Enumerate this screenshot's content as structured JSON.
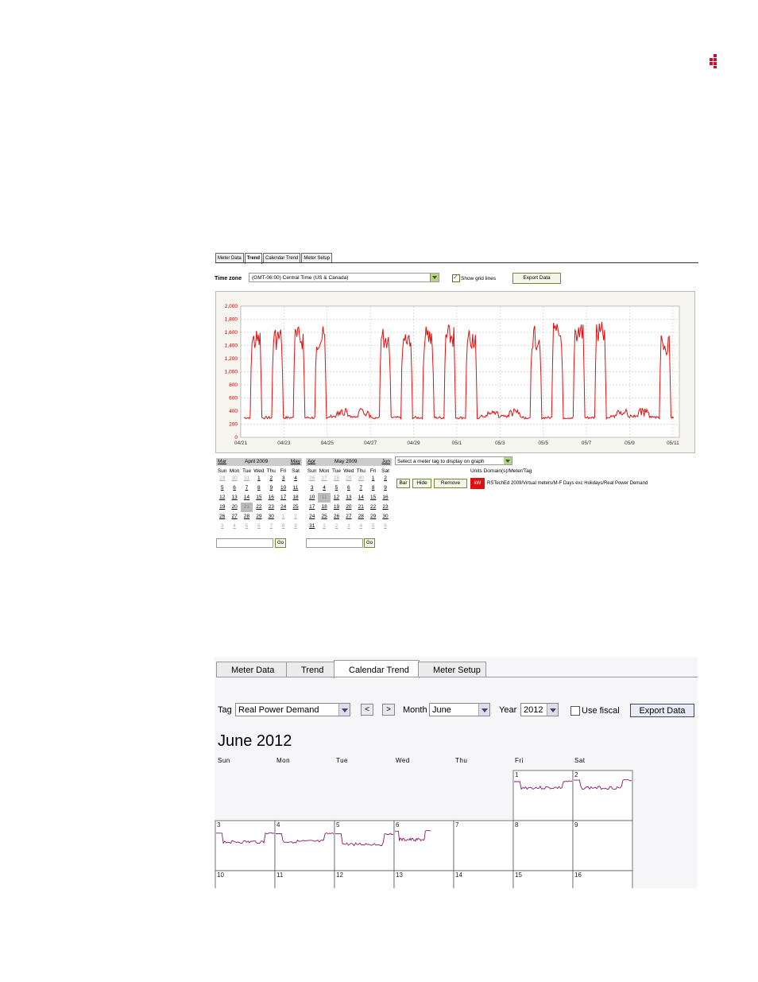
{
  "brand": {
    "logo_icon": "red-square-dots-logo",
    "accent": "#c8102e"
  },
  "trend_screen": {
    "tabs": [
      {
        "label": "Meter Data"
      },
      {
        "label": "Trend",
        "active": true
      },
      {
        "label": "Calendar Trend"
      },
      {
        "label": "Meter Setup"
      }
    ],
    "time_zone_label": "Time zone",
    "time_zone_value": "(GMT-06:00) Central Time (US & Canada)",
    "show_grid_lines_label": "Show grid lines",
    "show_grid_lines_checked": true,
    "export_label": "Export Data",
    "calendars": [
      {
        "prev": "Mar",
        "title": "April 2009",
        "next": "May",
        "dow": [
          "Sun",
          "Mon",
          "Tue",
          "Wed",
          "Thu",
          "Fri",
          "Sat"
        ],
        "weeks": [
          [
            "29",
            "30",
            "31",
            "1",
            "2",
            "3",
            "4"
          ],
          [
            "5",
            "6",
            "7",
            "8",
            "9",
            "10",
            "11"
          ],
          [
            "12",
            "13",
            "14",
            "15",
            "16",
            "17",
            "18"
          ],
          [
            "19",
            "20",
            "21",
            "22",
            "23",
            "24",
            "25"
          ],
          [
            "26",
            "27",
            "28",
            "29",
            "30",
            "1",
            "2"
          ],
          [
            "3",
            "4",
            "5",
            "6",
            "7",
            "8",
            "9"
          ]
        ],
        "go_label": "Go"
      },
      {
        "prev": "Apr",
        "title": "May 2009",
        "next": "Jun",
        "dow": [
          "Sun",
          "Mon",
          "Tue",
          "Wed",
          "Thu",
          "Fri",
          "Sat"
        ],
        "weeks": [
          [
            "26",
            "27",
            "28",
            "29",
            "30",
            "1",
            "2"
          ],
          [
            "3",
            "4",
            "5",
            "6",
            "7",
            "8",
            "9"
          ],
          [
            "10",
            "11",
            "12",
            "13",
            "14",
            "15",
            "16"
          ],
          [
            "17",
            "18",
            "19",
            "20",
            "21",
            "22",
            "23"
          ],
          [
            "24",
            "25",
            "26",
            "27",
            "28",
            "29",
            "30"
          ],
          [
            "31",
            "1",
            "2",
            "3",
            "4",
            "5",
            "6"
          ]
        ],
        "go_label": "Go"
      }
    ],
    "meter_tag_select": "Select a meter tag to display on graph",
    "units_header": "Units Domain(s)/Meter/Tag",
    "buttons": {
      "bar": "Bar",
      "hide": "Hide",
      "remove": "Remove"
    },
    "unit_badge": "kW",
    "tag_path": "RSTechEd 2009/Virtual meters/M-F Days exc Holidays/Real Power Demand"
  },
  "chart_data": {
    "type": "line",
    "x_tick_labels": [
      "04/21",
      "04/23",
      "04/25",
      "04/27",
      "04/29",
      "05/1",
      "05/3",
      "05/5",
      "05/7",
      "05/9",
      "05/11"
    ],
    "y_tick_labels": [
      "0",
      "200",
      "400",
      "600",
      "800",
      "1,000",
      "1,200",
      "1,400",
      "1,600",
      "1,800",
      "2,000"
    ],
    "ylim": [
      0,
      2000
    ],
    "grid": true,
    "line_color": "#e01010",
    "series": [
      {
        "daily_peak": [
          1650,
          1700,
          1700,
          1700,
          440,
          440,
          1700,
          1720,
          1700,
          1720,
          1720,
          440,
          440,
          1700,
          1750,
          1820,
          1760,
          440,
          440,
          1600
        ],
        "base": [
          300,
          300,
          300,
          300,
          320,
          320,
          300,
          300,
          300,
          300,
          300,
          320,
          320,
          300,
          300,
          300,
          300,
          320,
          320,
          300
        ]
      }
    ]
  },
  "calendar_trend_screen": {
    "tabs": [
      {
        "label": "Meter Data"
      },
      {
        "label": "Trend"
      },
      {
        "label": "Calendar Trend",
        "active": true
      },
      {
        "label": "Meter Setup"
      }
    ],
    "tag_label": "Tag",
    "tag_value": "Real Power Demand",
    "prev_label": "<",
    "next_label": ">",
    "month_label": "Month",
    "month_value": "June",
    "year_label": "Year",
    "year_value": "2012",
    "use_fiscal_label": "Use fiscal",
    "use_fiscal_checked": false,
    "export_label": "Export Data",
    "title": "June 2012",
    "dow": [
      "Sun",
      "Mon",
      "Tue",
      "Wed",
      "Thu",
      "Fri",
      "Sat"
    ],
    "rows": [
      [
        "",
        "",
        "",
        "",
        "",
        "1",
        "2"
      ],
      [
        "3",
        "4",
        "5",
        "6",
        "7",
        "8",
        "9"
      ],
      [
        "10",
        "11",
        "12",
        "13",
        "14",
        "15",
        "16"
      ]
    ],
    "sparkline_color": "#8a1a6a",
    "has_sparkline": [
      "1",
      "2",
      "3",
      "4",
      "5",
      "6"
    ]
  }
}
